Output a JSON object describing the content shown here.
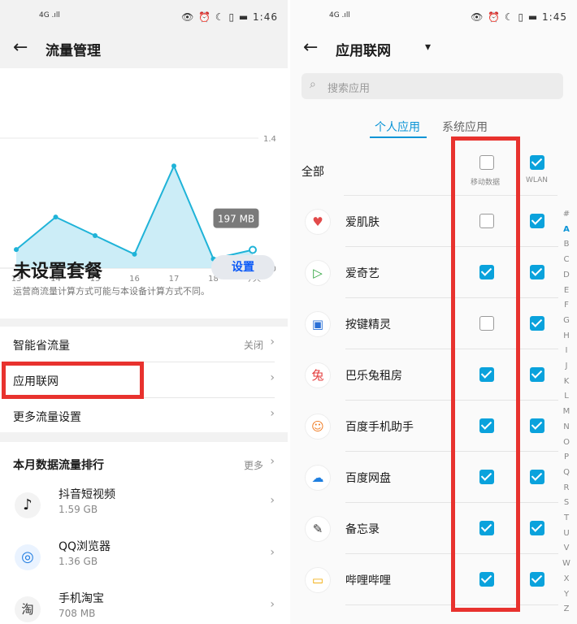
{
  "left": {
    "status": {
      "signal": "4G .ıll",
      "icons": "👁 ⏰ ☾ ▯ ▬",
      "time": "1:46"
    },
    "title": "流量管理",
    "chart_data": {
      "type": "area",
      "x": [
        "13",
        "14",
        "15",
        "16",
        "17",
        "18",
        "今天"
      ],
      "values": [
        0.2,
        0.55,
        0.35,
        0.15,
        1.1,
        0.1,
        0.197
      ],
      "ylim": [
        0.0,
        1.4
      ],
      "y_ticks": [
        "1.4",
        "0.0"
      ],
      "tooltip": "197 MB",
      "line_color": "#1fb3d8",
      "fill_color": "#bfe8f5"
    },
    "plan_title": "未设置套餐",
    "set_label": "设置",
    "plan_note": "运营商流量计算方式可能与本设备计算方式不同。",
    "settings": [
      {
        "label": "智能省流量",
        "value": "关闭"
      },
      {
        "label": "应用联网",
        "value": ""
      },
      {
        "label": "更多流量设置",
        "value": ""
      }
    ],
    "rank_title": "本月数据流量排行",
    "rank_more": "更多",
    "apps": [
      {
        "name": "抖音短视频",
        "size": "1.59 GB",
        "icon": "douyin-icon",
        "glyph": "♪"
      },
      {
        "name": "QQ浏览器",
        "size": "1.36 GB",
        "icon": "qq-browser-icon",
        "glyph": "◎"
      },
      {
        "name": "手机淘宝",
        "size": "708 MB",
        "icon": "taobao-icon",
        "glyph": "淘"
      }
    ]
  },
  "right": {
    "status": {
      "signal": "4G .ıll",
      "icons": "👁 ⏰ ☾ ▯ ▬",
      "time": "1:45"
    },
    "title": "应用联网",
    "dropdown_glyph": "▾",
    "search_placeholder": "搜索应用",
    "tabs": [
      "个人应用",
      "系统应用"
    ],
    "all_label": "全部",
    "col_mobile": "移动数据",
    "col_wlan": "WLAN",
    "header_mobile_checked": false,
    "header_wlan_checked": true,
    "apps": [
      {
        "name": "爱肌肤",
        "mobile": false,
        "wlan": true,
        "icon": "aijifu-icon",
        "glyph": "♥",
        "color": "#e24a4a"
      },
      {
        "name": "爱奇艺",
        "mobile": true,
        "wlan": true,
        "icon": "iqiyi-icon",
        "glyph": "▷",
        "color": "#2aa33a"
      },
      {
        "name": "按键精灵",
        "mobile": false,
        "wlan": true,
        "icon": "anjian-icon",
        "glyph": "▣",
        "color": "#2a6fd6"
      },
      {
        "name": "巴乐兔租房",
        "mobile": true,
        "wlan": true,
        "icon": "baletu-icon",
        "glyph": "兔",
        "color": "#e33b3b"
      },
      {
        "name": "百度手机助手",
        "mobile": true,
        "wlan": true,
        "icon": "baidu-assistant-icon",
        "glyph": "☺",
        "color": "#f07b22"
      },
      {
        "name": "百度网盘",
        "mobile": true,
        "wlan": true,
        "icon": "baidu-netdisk-icon",
        "glyph": "☁",
        "color": "#1f7fe0"
      },
      {
        "name": "备忘录",
        "mobile": true,
        "wlan": true,
        "icon": "memo-icon",
        "glyph": "✎",
        "color": "#333333"
      },
      {
        "name": "哔哩哔哩",
        "mobile": true,
        "wlan": true,
        "icon": "bilibili-icon",
        "glyph": "▭",
        "color": "#f2a900"
      }
    ],
    "index_letters": [
      "#",
      "A",
      "B",
      "C",
      "D",
      "E",
      "F",
      "G",
      "H",
      "I",
      "J",
      "K",
      "L",
      "M",
      "N",
      "O",
      "P",
      "Q",
      "R",
      "S",
      "T",
      "U",
      "V",
      "W",
      "X",
      "Y",
      "Z"
    ],
    "index_active": "A"
  }
}
